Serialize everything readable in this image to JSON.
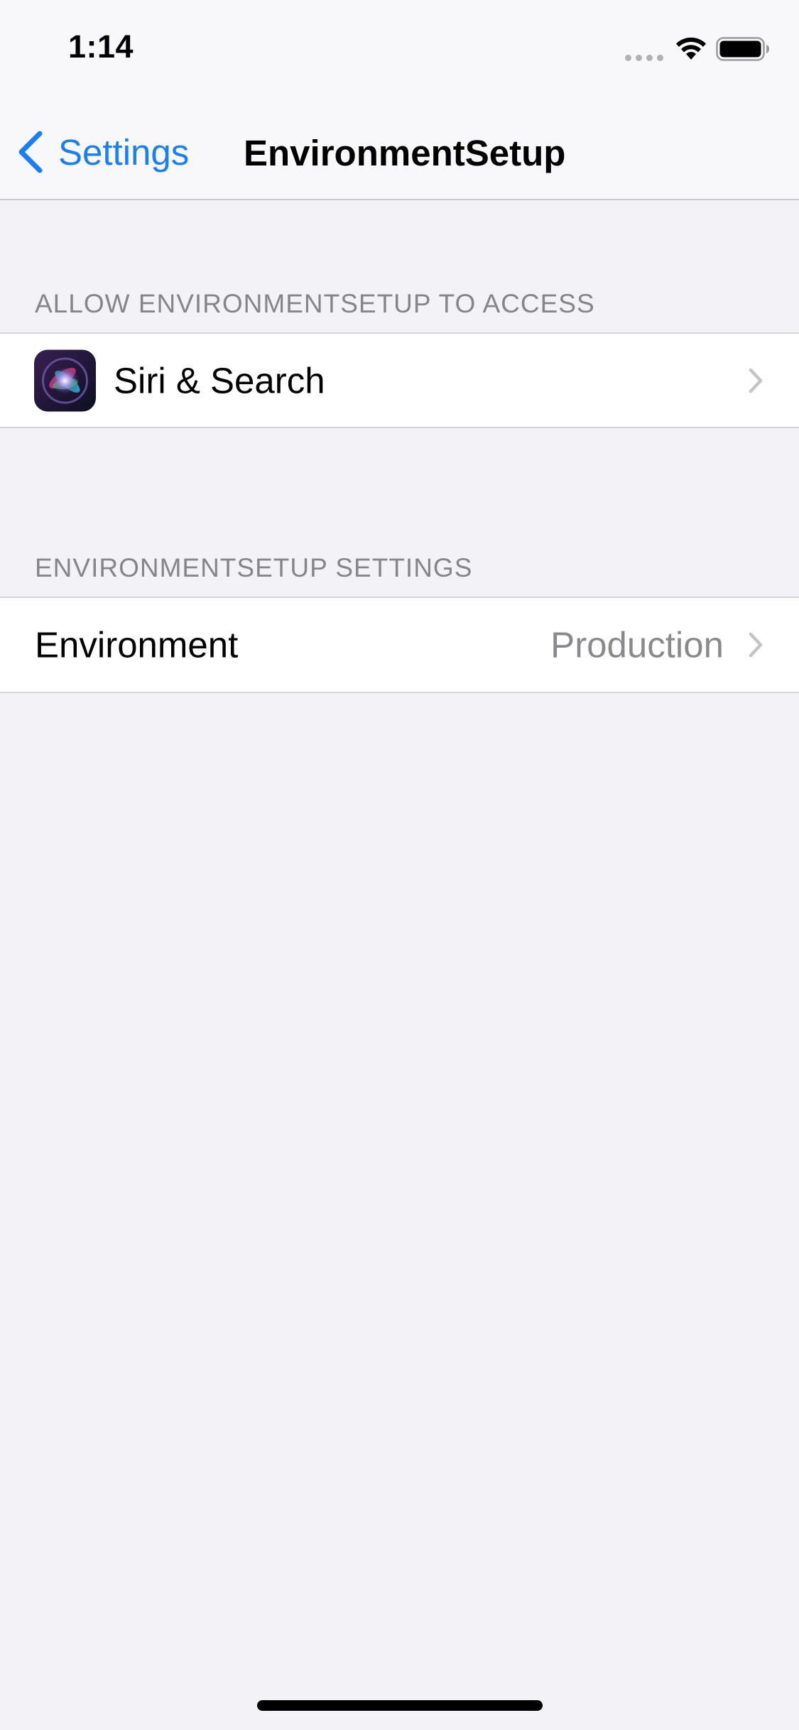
{
  "status_bar": {
    "time": "1:14",
    "signal_icon": "cellular-dots-icon",
    "wifi_icon": "wifi-icon",
    "battery_icon": "battery-icon"
  },
  "nav": {
    "back_label": "Settings",
    "back_icon": "chevron-left-icon",
    "title": "EnvironmentSetup",
    "accent_color": "#1a7ef5"
  },
  "sections": [
    {
      "header": "ALLOW ENVIRONMENTSETUP TO ACCESS",
      "rows": [
        {
          "icon": "siri-icon",
          "label": "Siri & Search",
          "accessory": "chevron-right-icon"
        }
      ]
    },
    {
      "header": "ENVIRONMENTSETUP SETTINGS",
      "rows": [
        {
          "label": "Environment",
          "value": "Production",
          "accessory": "chevron-right-icon"
        }
      ]
    }
  ]
}
